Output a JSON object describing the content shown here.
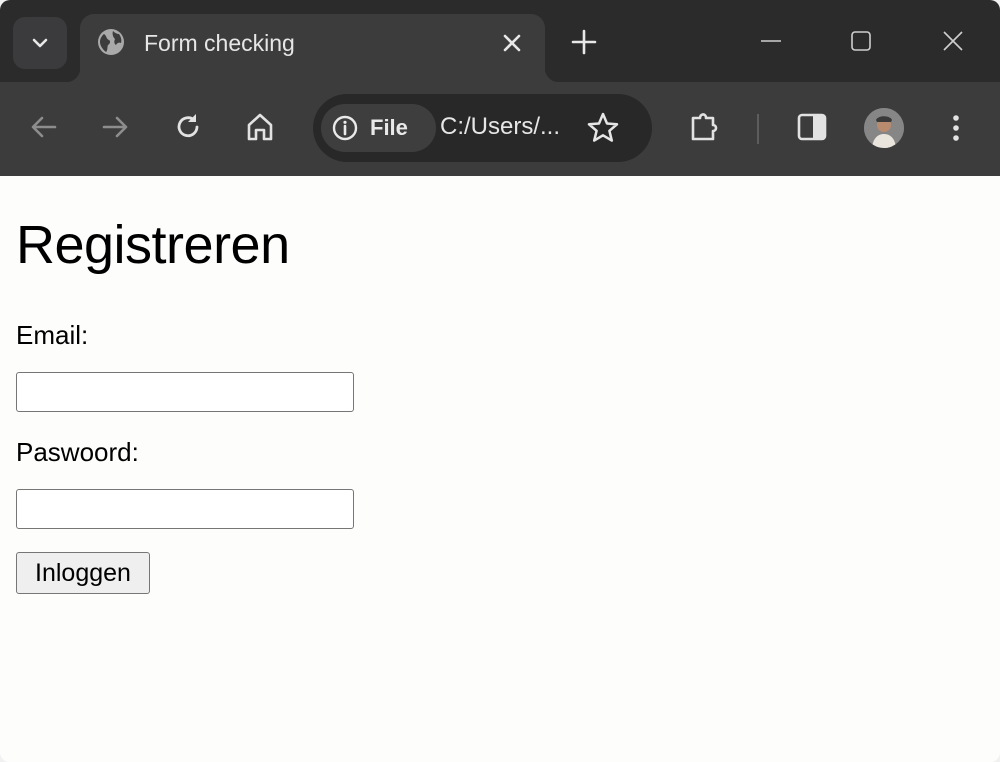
{
  "browser": {
    "tab": {
      "title": "Form checking",
      "favicon": "globe-icon"
    },
    "toolbar": {
      "site_chip_label": "File",
      "url": "C:/Users/..."
    }
  },
  "page": {
    "heading": "Registreren",
    "form": {
      "email_label": "Email:",
      "email_value": "",
      "password_label": "Paswoord:",
      "password_value": "",
      "submit_label": "Inloggen"
    }
  },
  "colors": {
    "tabstrip_bg": "#2b2b2c",
    "toolbar_bg": "#3c3c3c",
    "page_bg": "#fdfdfc"
  }
}
